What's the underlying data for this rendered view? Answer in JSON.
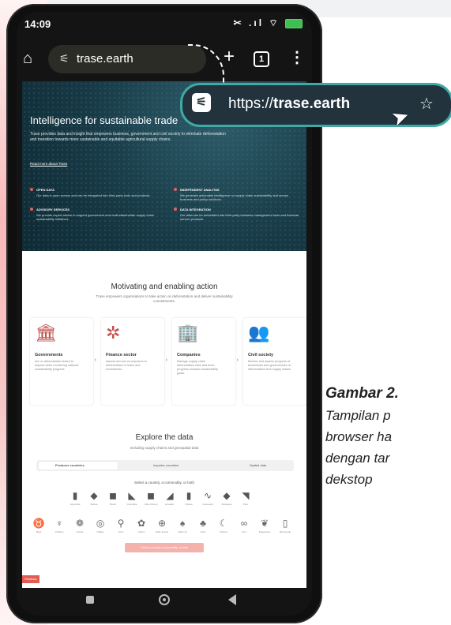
{
  "status_bar": {
    "time": "14:09",
    "icons": "✂ .ıl ⌔"
  },
  "browser": {
    "url_short": "trase.earth",
    "tab_count": "1"
  },
  "callout": {
    "url_prefix": "https://",
    "url_domain": "trase.earth"
  },
  "hero": {
    "title": "Intelligence for sustainable trade",
    "description": "Trase provides data and insight that empowers business, government and civil society to eliminate deforestation and transition towards more sustainable and equitable agricultural supply chains.",
    "link": "Read more about Trase",
    "features": [
      {
        "title": "OPEN DATA",
        "text": "Our data is open access and can be integrated into third-party tools and products."
      },
      {
        "title": "INDEPENDENT ANALYSIS",
        "text": "We generate actionable intelligence on supply chain sustainability and across business and policy solutions."
      },
      {
        "title": "ADVISORY SERVICES",
        "text": "We provide expert advice to support government and multi-stakeholder supply chain sustainability initiatives."
      },
      {
        "title": "DATA INTEGRATION",
        "text": "Our data can be embedded into third-party business management tools and financial service products."
      }
    ]
  },
  "section": {
    "title": "Motivating and enabling action",
    "subtitle": "Trase empowers organisations to take action on deforestation and deliver sustainability commitments.",
    "cards": [
      {
        "title": "Governments",
        "text": "Act on deforestation linked to imports while monitoring national sustainability progress."
      },
      {
        "title": "Finance sector",
        "text": "Assess and act on exposure to deforestation in loans and investments."
      },
      {
        "title": "Companies",
        "text": "Manage supply chain deforestation risks and drive progress towards sustainability goals."
      },
      {
        "title": "Civil society",
        "text": "Monitor and assess progress of businesses and governments on deforestation-free supply chains."
      }
    ]
  },
  "explore": {
    "title": "Explore the data",
    "subtitle": "Including supply chains and geospatial data",
    "tabs": [
      "Producer countries",
      "Importer countries",
      "Spatial data"
    ],
    "select_label": "Select a country, a commodity, or both",
    "countries": [
      "Argentina",
      "Bolivia",
      "Brazil",
      "Colombia",
      "Côte d'Ivoire",
      "Ecuador",
      "Ghana",
      "Indonesia",
      "Paraguay",
      "Peru"
    ],
    "commodities": [
      "Beef",
      "Chicken",
      "Cocoa",
      "Coffee",
      "Corn",
      "Cotton",
      "Palm kernel",
      "Palm oil",
      "Pork",
      "Shrimp",
      "Soy",
      "Sugarcane",
      "Wood pulp"
    ],
    "cta": "Select a country, a commodity, or both",
    "feedback": "Feedback"
  },
  "caption": {
    "title": "Gambar 2.",
    "lines": [
      "Tampilan p",
      "browser ha",
      "dengan tar",
      "dekstop"
    ]
  },
  "colors": {
    "accent": "#c0504d",
    "hero_bg": "#173a46",
    "callout_border": "#3fa9a4"
  }
}
